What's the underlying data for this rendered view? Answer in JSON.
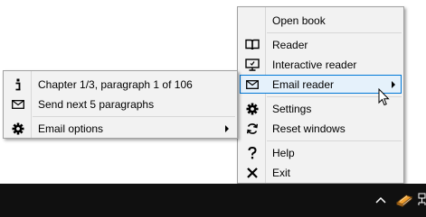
{
  "main_menu": {
    "items": [
      {
        "label": "Open book",
        "icon": "none"
      },
      {
        "label": "Reader",
        "icon": "book-icon"
      },
      {
        "label": "Interactive reader",
        "icon": "monitor-icon"
      },
      {
        "label": "Email reader",
        "icon": "envelope-icon",
        "has_submenu": true,
        "highlighted": true
      },
      {
        "label": "Settings",
        "icon": "gear-icon"
      },
      {
        "label": "Reset windows",
        "icon": "refresh-icon"
      },
      {
        "label": "Help",
        "icon": "question-icon"
      },
      {
        "label": "Exit",
        "icon": "close-icon"
      }
    ]
  },
  "email_submenu": {
    "items": [
      {
        "label": "Chapter 1/3, paragraph 1 of 106",
        "icon": "info-icon"
      },
      {
        "label": "Send next 5 paragraphs",
        "icon": "envelope-icon"
      },
      {
        "label": "Email options",
        "icon": "gear-icon",
        "has_submenu": true
      }
    ]
  },
  "colors": {
    "menu_background": "#f2f2f2",
    "highlight_fill": "#e5f1fb",
    "highlight_border": "#0078d7",
    "taskbar": "#101010",
    "tray_book": "#f0a030"
  },
  "tray": {
    "icons": [
      "chevron-up-icon",
      "book-icon",
      "network-icon"
    ]
  }
}
